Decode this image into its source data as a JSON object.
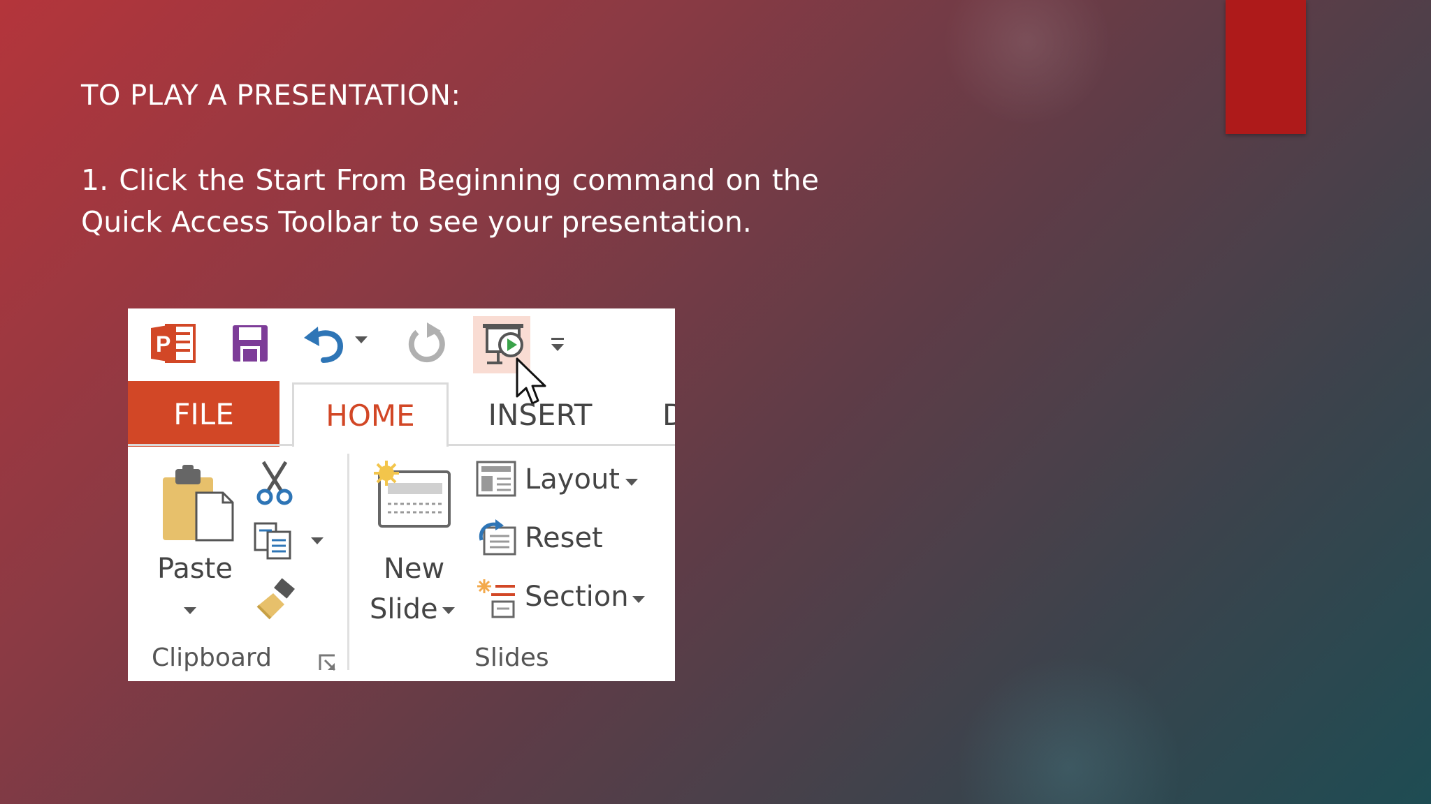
{
  "slide": {
    "heading": "TO PLAY A PRESENTATION:",
    "paragraph": "1. Click the Start From Beginning command on the Quick Access Toolbar to see your presentation."
  },
  "ribbon": {
    "tabs": {
      "file": "FILE",
      "home": "HOME",
      "insert": "INSERT",
      "partial": "D"
    },
    "clipboard": {
      "paste_label": "Paste",
      "group_label": "Clipboard"
    },
    "slides": {
      "new_slide_label_1": "New",
      "new_slide_label_2": "Slide",
      "layout_label": "Layout",
      "reset_label": "Reset",
      "section_label": "Section",
      "group_label": "Slides"
    }
  },
  "quick_access": {
    "icons": [
      "powerpoint-logo-icon",
      "save-icon",
      "undo-icon",
      "redo-icon",
      "start-from-beginning-icon",
      "customize-toolbar-icon"
    ]
  },
  "colors": {
    "accent": "#d24726",
    "highlight": "#f9dcd3",
    "red_tab": "#ae1a1a"
  }
}
